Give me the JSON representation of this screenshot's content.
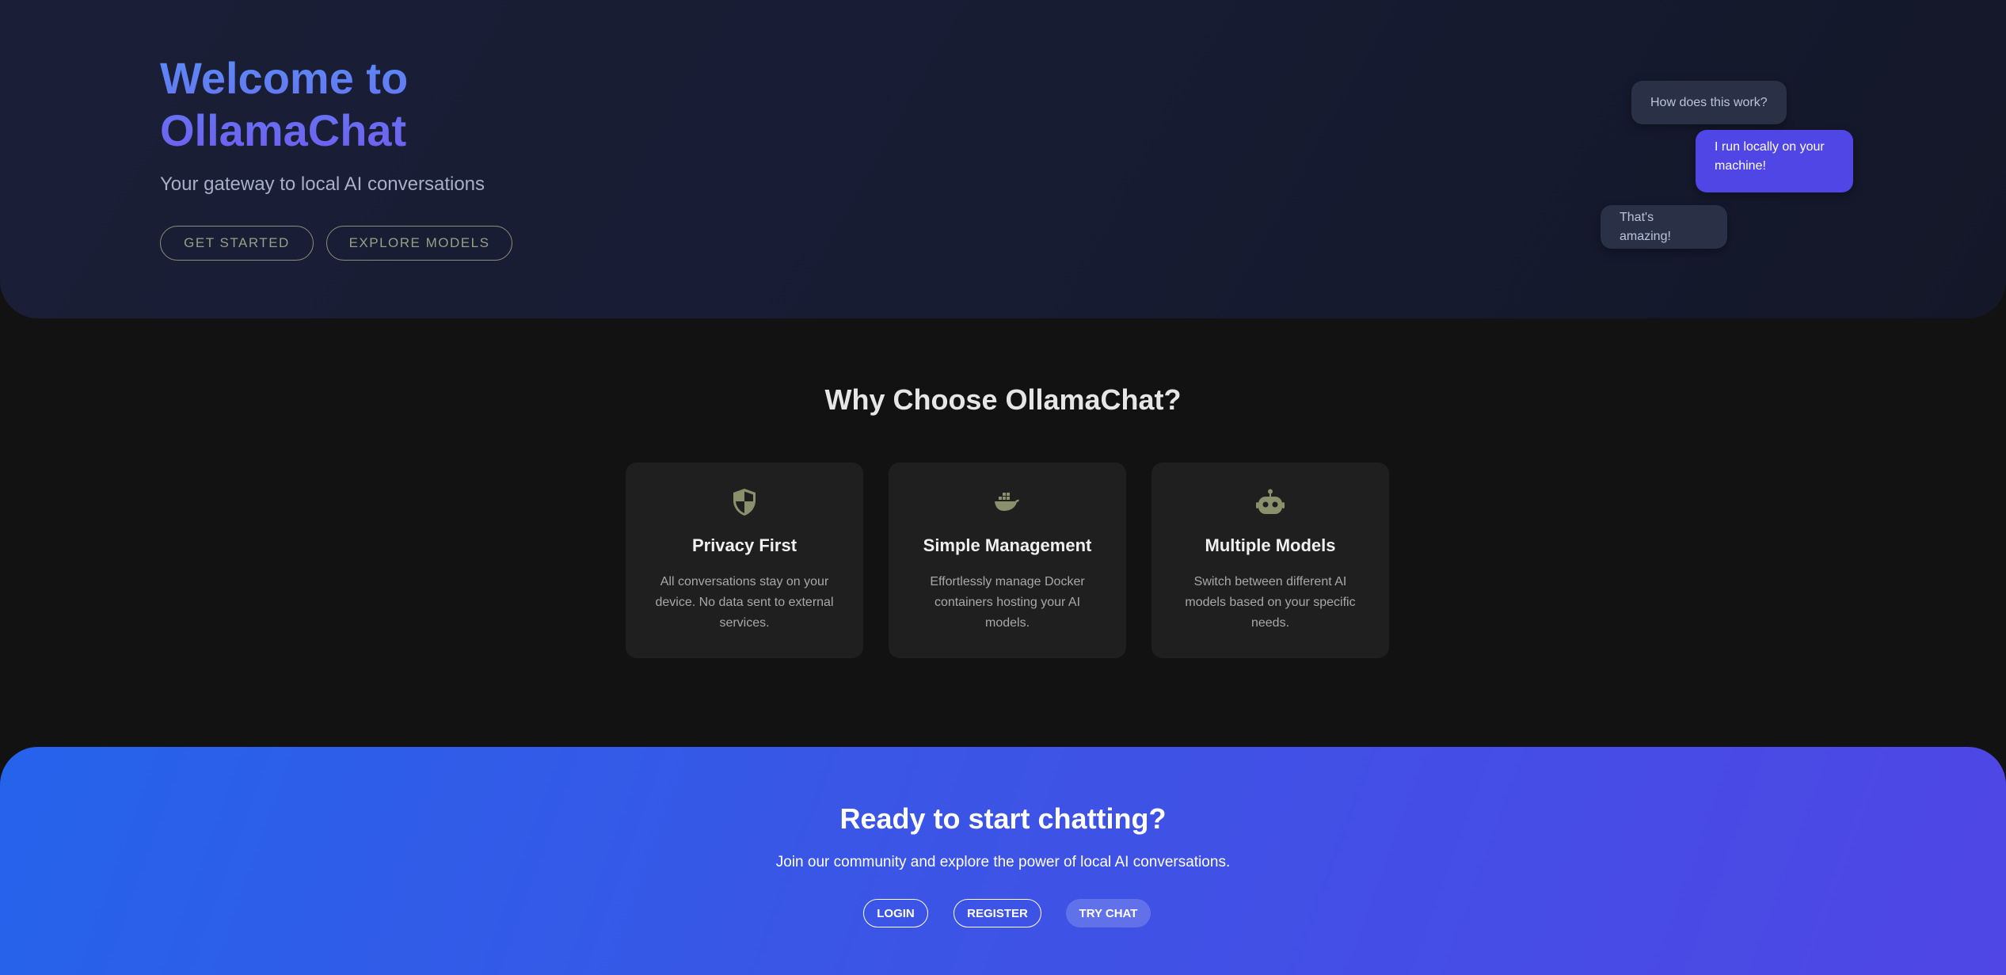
{
  "hero": {
    "title_line1": "Welcome to",
    "title_line2": "OllamaChat",
    "subtitle": "Your gateway to local AI conversations",
    "buttons": {
      "get_started": "GET STARTED",
      "explore_models": "EXPLORE MODELS"
    },
    "chat_preview": {
      "question": "How does this work?",
      "answer": "I run locally on your machine!",
      "reply": "That's amazing!"
    }
  },
  "features": {
    "title": "Why Choose OllamaChat?",
    "cards": [
      {
        "icon": "shield-icon",
        "title": "Privacy First",
        "description": "All conversations stay on your device. No data sent to external services."
      },
      {
        "icon": "docker-icon",
        "title": "Simple Management",
        "description": "Effortlessly manage Docker containers hosting your AI models."
      },
      {
        "icon": "robot-icon",
        "title": "Multiple Models",
        "description": "Switch between different AI models based on your specific needs."
      }
    ]
  },
  "cta": {
    "title": "Ready to start chatting?",
    "subtitle": "Join our community and explore the power of local AI conversations.",
    "buttons": {
      "login": "LOGIN",
      "register": "REGISTER",
      "try_chat": "TRY CHAT"
    }
  },
  "colors": {
    "hero_bg": "#1a1e36",
    "page_bg": "#121212",
    "card_bg": "#1f1f1f",
    "accent_blue": "#2563eb",
    "accent_indigo": "#4f46e5",
    "icon_olive": "#8a8f6c"
  }
}
